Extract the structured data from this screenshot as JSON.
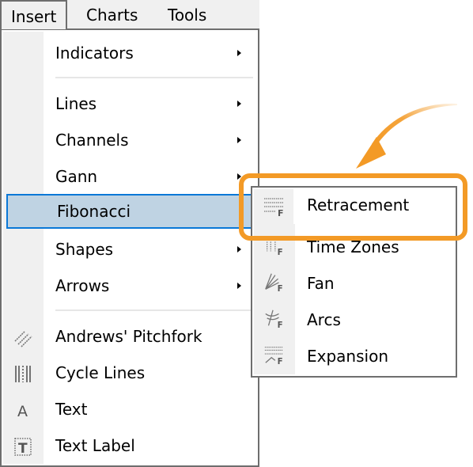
{
  "menubar": {
    "items": [
      {
        "label": "Insert",
        "active": true
      },
      {
        "label": "Charts",
        "active": false
      },
      {
        "label": "Tools",
        "active": false
      }
    ]
  },
  "insert_menu": {
    "items": [
      {
        "label": "Indicators",
        "submenu": true,
        "icon": ""
      },
      {
        "label": "Lines",
        "submenu": true,
        "icon": ""
      },
      {
        "label": "Channels",
        "submenu": true,
        "icon": ""
      },
      {
        "label": "Gann",
        "submenu": true,
        "icon": ""
      },
      {
        "label": "Fibonacci",
        "submenu": true,
        "icon": "",
        "highlighted": true
      },
      {
        "label": "Shapes",
        "submenu": true,
        "icon": ""
      },
      {
        "label": "Arrows",
        "submenu": true,
        "icon": ""
      },
      {
        "label": "Andrews' Pitchfork",
        "submenu": false,
        "icon": "pitchfork-icon"
      },
      {
        "label": "Cycle Lines",
        "submenu": false,
        "icon": "cycle-lines-icon"
      },
      {
        "label": "Text",
        "submenu": false,
        "icon": "text-icon"
      },
      {
        "label": "Text Label",
        "submenu": false,
        "icon": "text-label-icon"
      }
    ]
  },
  "fibonacci_submenu": {
    "items": [
      {
        "label": "Retracement",
        "icon": "fibo-retracement-icon",
        "emphasized": true
      },
      {
        "label": "Time Zones",
        "icon": "fibo-time-zones-icon"
      },
      {
        "label": "Fan",
        "icon": "fibo-fan-icon"
      },
      {
        "label": "Arcs",
        "icon": "fibo-arcs-icon"
      },
      {
        "label": "Expansion",
        "icon": "fibo-expansion-icon"
      }
    ],
    "icon_badge": "F"
  },
  "annotation": {
    "highlight_color": "#f39a26",
    "target": "Retracement"
  },
  "colors": {
    "menu_hover_bg": "#bfd3e3",
    "menu_hover_border": "#0a78d7",
    "gutter": "#f0f0f0",
    "border": "#6e6e6e"
  }
}
